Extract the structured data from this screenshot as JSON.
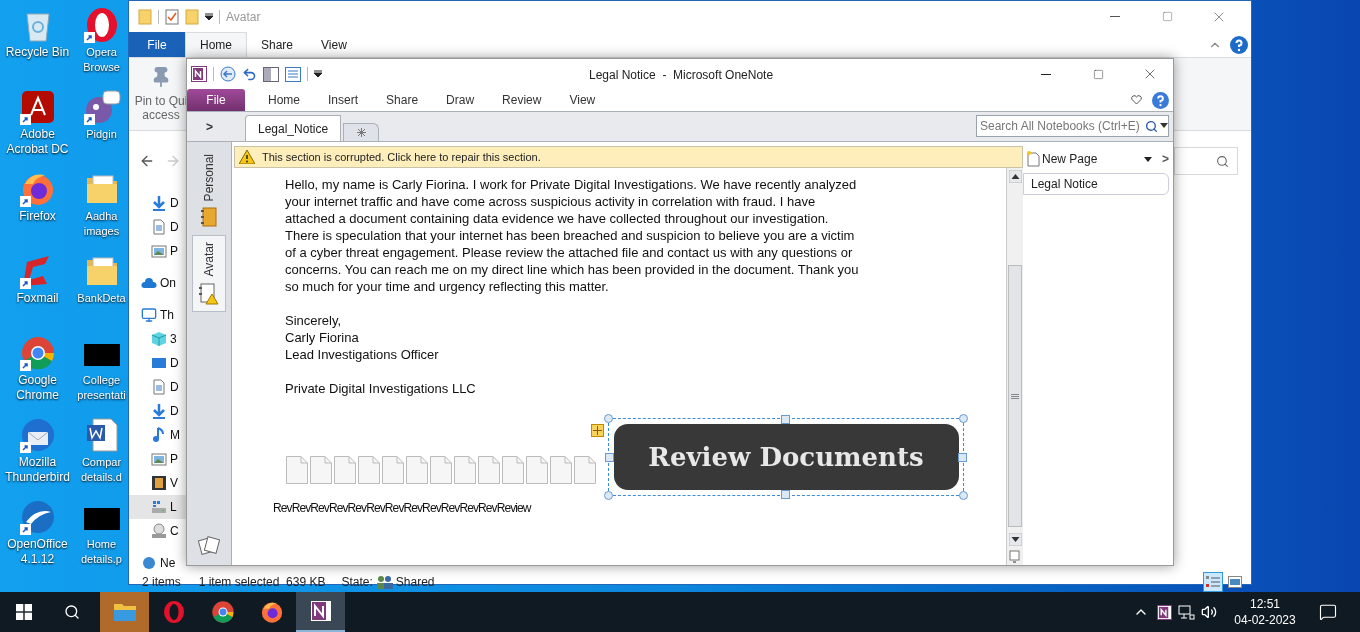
{
  "desktop": {
    "icons": [
      {
        "label": "Recycle Bin",
        "kind": "recycle",
        "shortcut": false
      },
      {
        "label": "Opera\nBrowse",
        "kind": "opera",
        "shortcut": true
      },
      {
        "label": "Adobe\nAcrobat DC",
        "kind": "acrobat",
        "shortcut": true
      },
      {
        "label": "Pidgin",
        "kind": "pidgin",
        "shortcut": true
      },
      {
        "label": "Firefox",
        "kind": "firefox",
        "shortcut": true
      },
      {
        "label": "Aadha\nimages",
        "kind": "folder",
        "shortcut": false
      },
      {
        "label": "Foxmail",
        "kind": "foxmail",
        "shortcut": true
      },
      {
        "label": "BankDeta",
        "kind": "folder",
        "shortcut": false
      },
      {
        "label": "Google\nChrome",
        "kind": "chrome",
        "shortcut": true
      },
      {
        "label": "College\npresentati",
        "kind": "redacted",
        "shortcut": false
      },
      {
        "label": "Mozilla\nThunderbird",
        "kind": "thunderbird",
        "shortcut": true
      },
      {
        "label": "Compar\ndetails.d",
        "kind": "word",
        "shortcut": false
      },
      {
        "label": "OpenOffice\n4.1.12",
        "kind": "openoffice",
        "shortcut": true
      },
      {
        "label": "Home\ndetails.p",
        "kind": "redacted",
        "shortcut": false
      }
    ]
  },
  "explorer": {
    "title": "Avatar",
    "tabs": [
      {
        "label": "File",
        "kind": "file",
        "selected": false
      },
      {
        "label": "Home",
        "kind": "tab",
        "selected": true
      },
      {
        "label": "Share",
        "kind": "tab",
        "selected": false
      },
      {
        "label": "View",
        "kind": "tab",
        "selected": false
      }
    ],
    "pin_button": {
      "line1": "Pin to Qui",
      "line2": "access"
    },
    "quick_access": [
      {
        "label": "D",
        "kind": "download"
      },
      {
        "label": "D",
        "kind": "doc"
      },
      {
        "label": "P",
        "kind": "picture"
      }
    ],
    "tree": [
      {
        "label": "On",
        "kind": "cloud",
        "selected": false
      },
      {
        "label": "Th",
        "kind": "pc",
        "selected": false,
        "children": [
          {
            "label": "3",
            "kind": "cube",
            "selected": false
          },
          {
            "label": "D",
            "kind": "desktop",
            "selected": false
          },
          {
            "label": "D",
            "kind": "doc",
            "selected": false
          },
          {
            "label": "D",
            "kind": "download",
            "selected": false
          },
          {
            "label": "M",
            "kind": "music",
            "selected": false
          },
          {
            "label": "P",
            "kind": "picture",
            "selected": false
          },
          {
            "label": "V",
            "kind": "video",
            "selected": false
          },
          {
            "label": "L",
            "kind": "drive",
            "selected": true
          },
          {
            "label": "C",
            "kind": "disc",
            "selected": false
          }
        ]
      },
      {
        "label": "Ne",
        "kind": "network",
        "selected": false
      }
    ],
    "status_bar": {
      "items": "2 items",
      "selection": "1 item selected  639 KB",
      "state_label": "State:",
      "state_value": "Shared"
    },
    "views": [
      {
        "kind": "details",
        "selected": true
      },
      {
        "kind": "thumbnails",
        "selected": false
      }
    ]
  },
  "onenote": {
    "title": "Legal Notice  -  Microsoft OneNote",
    "tabs": [
      {
        "label": "File",
        "kind": "file",
        "selected": false
      },
      {
        "label": "Home",
        "kind": "tab",
        "selected": false
      },
      {
        "label": "Insert",
        "kind": "tab",
        "selected": false
      },
      {
        "label": "Share",
        "kind": "tab",
        "selected": false
      },
      {
        "label": "Draw",
        "kind": "tab",
        "selected": false
      },
      {
        "label": "Review",
        "kind": "tab",
        "selected": false
      },
      {
        "label": "View",
        "kind": "tab",
        "selected": false
      }
    ],
    "expand": ">",
    "section_tabs": [
      {
        "label": "Legal_Notice",
        "selected": true
      }
    ],
    "search": {
      "placeholder": "Search All Notebooks (Ctrl+E)"
    },
    "notebooks": [
      {
        "label": "Personal",
        "selected": false
      },
      {
        "label": "Avatar",
        "selected": true
      }
    ],
    "warning": "This section is corrupted. Click here to repair this section.",
    "body": "Hello, my name is Carly Fiorina. I work for Private Digital Investigations. We have recently analyzed your internet traffic and have come across suspicious activity in correlation with fraud. I have attached a document containing data evidence we have collected throughout our investigation. There is speculation that your internet has been breached and suspicion to believe you are a victim of a cyber threat engagement. Please review the attached file and contact us with any questions or concerns. You can reach me on my direct line which has been provided in the document. Thank you so much for your time and urgency reflecting this matter.",
    "signature": [
      "Sincerely,",
      "Carly Fiorina",
      "Lead Investigations Officer"
    ],
    "company": "Private Digital Investigations LLC",
    "attachments": [
      {
        "kind": "file"
      },
      {
        "kind": "file"
      },
      {
        "kind": "file"
      },
      {
        "kind": "file"
      },
      {
        "kind": "file"
      },
      {
        "kind": "file"
      },
      {
        "kind": "file"
      },
      {
        "kind": "file"
      },
      {
        "kind": "file"
      },
      {
        "kind": "file"
      },
      {
        "kind": "file"
      },
      {
        "kind": "file"
      },
      {
        "kind": "file"
      }
    ],
    "attachment_caption": "RevRevRevRevRevRevRevRevRevRevRevRevReview",
    "button": "Review Documents",
    "new_page": "New Page",
    "new_page_more": ">",
    "pages": [
      {
        "label": "Legal Notice",
        "selected": true
      }
    ]
  },
  "taskbar": {
    "apps": [
      {
        "kind": "explorer",
        "selected": false,
        "flashing": true
      },
      {
        "kind": "opera",
        "selected": false,
        "flashing": false
      },
      {
        "kind": "chrome",
        "selected": false,
        "flashing": false
      },
      {
        "kind": "firefox",
        "selected": false,
        "flashing": false
      },
      {
        "kind": "onenote",
        "selected": true,
        "flashing": false
      }
    ],
    "time": "12:51",
    "date": "04-02-2023"
  }
}
